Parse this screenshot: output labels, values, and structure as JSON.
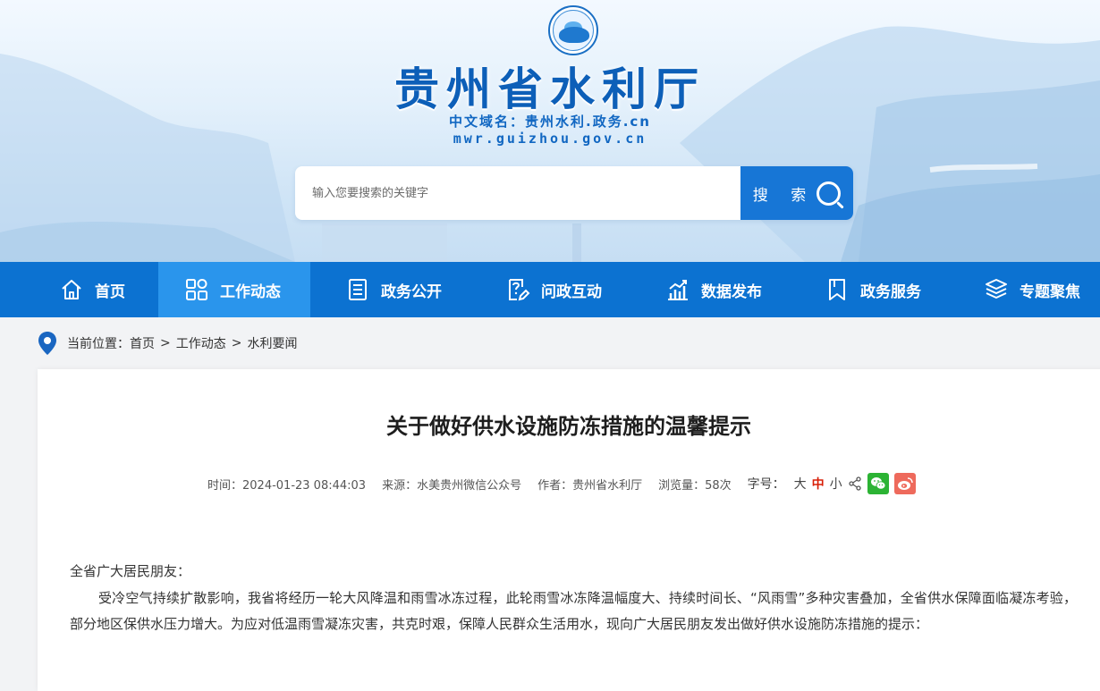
{
  "header": {
    "site_title": "贵州省水利厅",
    "domain_cn": "中文域名：贵州水利.政务.cn",
    "domain_en": "mwr.guizhou.gov.cn",
    "logo_icon": "water-emblem-icon"
  },
  "search": {
    "placeholder": "输入您要搜索的关键字",
    "button_label": "搜 索"
  },
  "nav": {
    "items": [
      {
        "label": "首页",
        "icon": "home-icon"
      },
      {
        "label": "工作动态",
        "icon": "grid-icon",
        "active": true
      },
      {
        "label": "政务公开",
        "icon": "document-list-icon"
      },
      {
        "label": "问政互动",
        "icon": "question-edit-icon"
      },
      {
        "label": "数据发布",
        "icon": "chart-icon"
      },
      {
        "label": "政务服务",
        "icon": "bookmark-icon"
      },
      {
        "label": "专题聚焦",
        "icon": "layers-icon"
      }
    ]
  },
  "breadcrumb": {
    "prefix": "当前位置：",
    "items": [
      "首页",
      "工作动态",
      "水利要闻"
    ],
    "separator": ">"
  },
  "article": {
    "title": "关于做好供水设施防冻措施的温馨提示",
    "time": "时间：2024-01-23 08:44:03",
    "source": "来源：水美贵州微信公众号",
    "author": "作者：贵州省水利厅",
    "views": "浏览量：58次",
    "font_size_label": "字号：",
    "font_sizes": [
      "大",
      "中",
      "小"
    ],
    "paragraphs": [
      "全省广大居民朋友：",
      "受冷空气持续扩散影响，我省将经历一轮大风降温和雨雪冰冻过程，此轮雨雪冰冻降温幅度大、持续时间长、“风雨雪”多种灾害叠加，全省供水保障面临凝冻考验，部分地区保供水压力增大。为应对低温雨雪凝冻灾害，共克时艰，保障人民群众生活用水，现向广大居民朋友发出做好供水设施防冻措施的提示："
    ]
  },
  "colors": {
    "nav_bg": "#0c72d1",
    "nav_active": "#2a95ec",
    "title_blue": "#0d5fb8",
    "current_size": "#d81e06",
    "wechat": "#2cb334",
    "weibo": "#ee6a5c"
  }
}
